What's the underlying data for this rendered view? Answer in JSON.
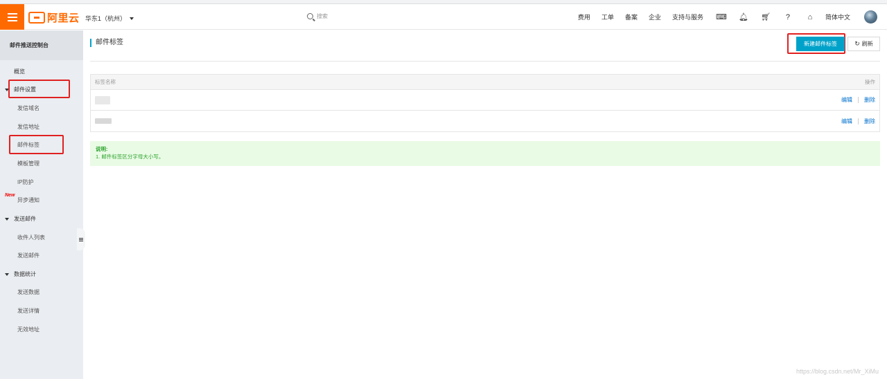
{
  "header": {
    "logo_text": "阿里云",
    "region": "华东1（杭州）",
    "search_placeholder": "搜索",
    "nav": {
      "fees": "费用",
      "tickets": "工单",
      "icp": "备案",
      "enterprise": "企业",
      "support": "支持与服务",
      "language": "简体中文"
    }
  },
  "sidebar": {
    "title": "邮件推送控制台",
    "overview": "概览",
    "new_badge": "New",
    "groups": [
      {
        "label": "邮件设置",
        "items": [
          "发信域名",
          "发信地址",
          "邮件标签",
          "模板管理",
          "IP防护",
          "异步通知"
        ]
      },
      {
        "label": "发送邮件",
        "items": [
          "收件人列表",
          "发送邮件"
        ]
      },
      {
        "label": "数据统计",
        "items": [
          "发送数据",
          "发送详情",
          "无效地址"
        ]
      }
    ]
  },
  "main": {
    "title": "邮件标签",
    "create_button": "新建邮件标签",
    "refresh_button": "刷新",
    "table": {
      "columns": [
        "标签名称",
        "操作"
      ],
      "rows": [
        {
          "edit": "编辑",
          "delete": "删除"
        },
        {
          "edit": "编辑",
          "delete": "删除"
        }
      ]
    },
    "notice": {
      "title": "说明:",
      "text": "1. 邮件标签区分字母大小写。"
    }
  },
  "watermark": "https://blog.csdn.net/Mr_XiMu",
  "colors": {
    "brand": "#ff6a00",
    "primary": "#00a2ca",
    "link": "#0070cc",
    "highlight": "#e02020",
    "notice_text": "#2fa32f"
  }
}
